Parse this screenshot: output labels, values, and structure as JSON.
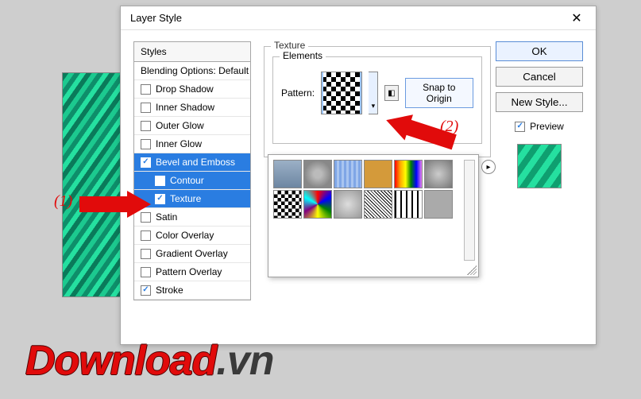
{
  "dialog": {
    "title": "Layer Style",
    "close_glyph": "✕"
  },
  "styles_header": "Styles",
  "blending_label": "Blending Options: Default",
  "styles": {
    "drop_shadow": "Drop Shadow",
    "inner_shadow": "Inner Shadow",
    "outer_glow": "Outer Glow",
    "inner_glow": "Inner Glow",
    "bevel_emboss": "Bevel and Emboss",
    "contour": "Contour",
    "texture": "Texture",
    "satin": "Satin",
    "color_overlay": "Color Overlay",
    "gradient_overlay": "Gradient Overlay",
    "pattern_overlay": "Pattern Overlay",
    "stroke": "Stroke"
  },
  "texture": {
    "group_label": "Texture",
    "elements_label": "Elements",
    "pattern_label": "Pattern:",
    "snap_label": "Snap to Origin",
    "dropdown_glyph": "▾",
    "tinybtn_glyph": "◧",
    "flyout_glyph": "▸"
  },
  "buttons": {
    "ok": "OK",
    "cancel": "Cancel",
    "new_style": "New Style...",
    "preview": "Preview"
  },
  "annotations": {
    "a1": "(1)",
    "a2": "(2)"
  },
  "watermark": {
    "main": "Download",
    "suffix": ".vn"
  }
}
